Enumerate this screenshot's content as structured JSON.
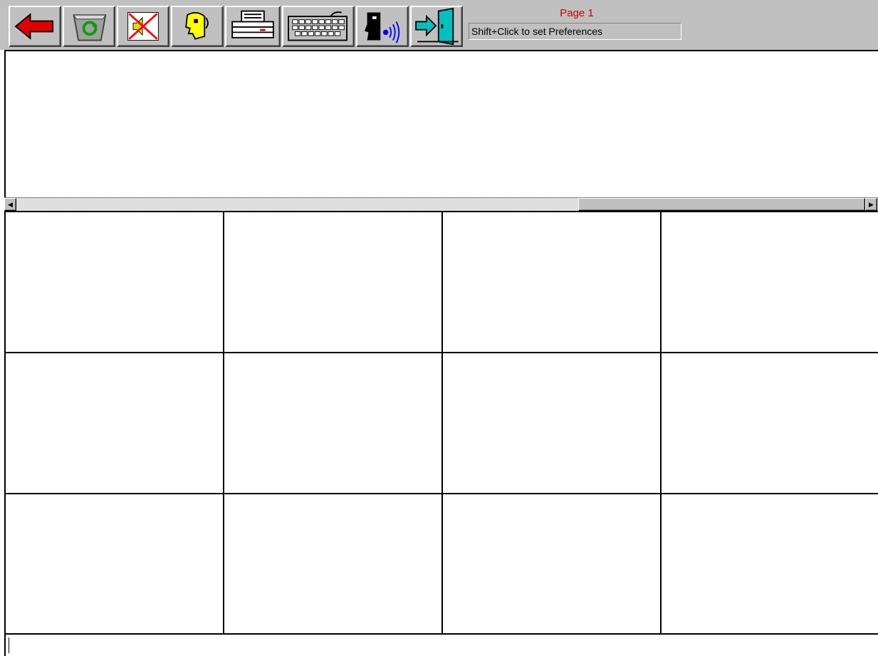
{
  "toolbar": {
    "page_label": "Page 1",
    "status_text": "Shift+Click to set Preferences",
    "buttons": [
      {
        "name": "back-arrow-icon",
        "color": "#e00000"
      },
      {
        "name": "recycle-bin-icon",
        "color": "#00a000"
      },
      {
        "name": "mute-speaker-icon",
        "color": "#ff0000"
      },
      {
        "name": "speaking-head-icon",
        "color": "#ffff00"
      },
      {
        "name": "printer-icon",
        "color": "#000000"
      },
      {
        "name": "keyboard-icon",
        "color": "#000000"
      },
      {
        "name": "voice-scan-icon",
        "color": "#0000ff"
      },
      {
        "name": "exit-door-icon",
        "color": "#00c0c0"
      }
    ]
  },
  "grid": {
    "rows": 3,
    "columns": 4
  }
}
